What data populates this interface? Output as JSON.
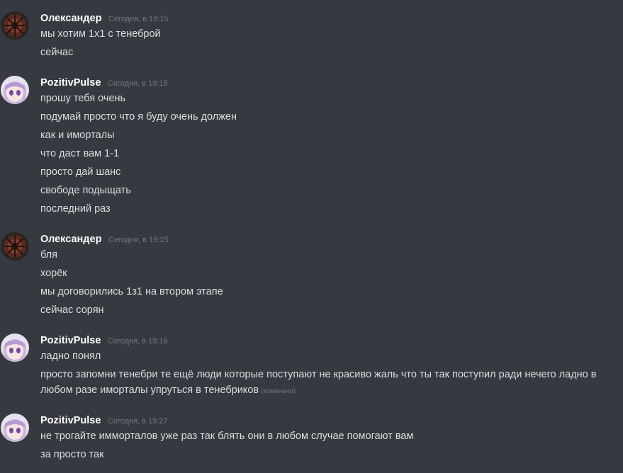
{
  "users": {
    "oleksander": {
      "name": "Олександер"
    },
    "pozitiv": {
      "name": "PozitivPulse"
    }
  },
  "colors": {
    "background": "#36393f",
    "username": "#ffffff",
    "message": "#dcddde",
    "muted": "#72767d"
  },
  "messages": [
    {
      "author": "Олександер",
      "timestamp": "Сегодня, в 19:15",
      "lines": [
        "мы хотим 1x1 с тенеброй",
        "сейчас"
      ]
    },
    {
      "author": "PozitivPulse",
      "timestamp": "Сегодня, в 19:15",
      "lines": [
        "прошу тебя очень",
        "подумай просто что я буду очень должен",
        "как и иморталы",
        "что даст вам 1-1",
        "просто дай шанс",
        "свободе подыщать",
        "последний раз"
      ]
    },
    {
      "author": "Олександер",
      "timestamp": "Сегодня, в 19:15",
      "lines": [
        "бля",
        "хорёк",
        "мы договорились 1з1 на втором этапе",
        "сейчас сорян"
      ]
    },
    {
      "author": "PozitivPulse",
      "timestamp": "Сегодня, в 19:16",
      "lines": [
        "ладно понял",
        "просто запомни тенебри те ещё люди которые поступают не красиво жаль что ты так поступил ради нечего ладно в любом разе иморталы упруться в тенебриков"
      ],
      "edited_label": "(изменено)"
    },
    {
      "author": "PozitivPulse",
      "timestamp": "Сегодня, в 19:27",
      "lines": [
        "не трогайте имморталов уже раз так блять они в любом случае помогают вам",
        "за просто так"
      ]
    }
  ]
}
